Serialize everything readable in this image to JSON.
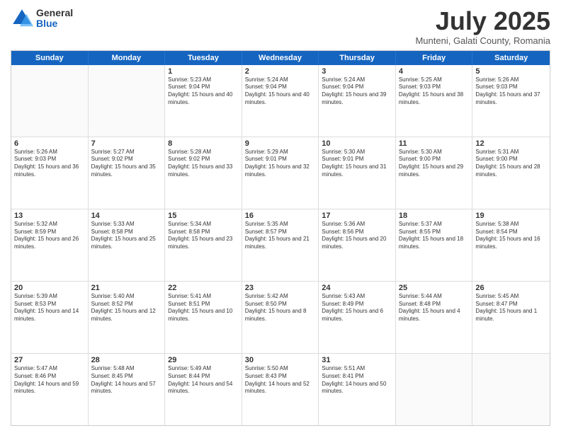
{
  "logo": {
    "general": "General",
    "blue": "Blue"
  },
  "title": "July 2025",
  "location": "Munteni, Galati County, Romania",
  "header_days": [
    "Sunday",
    "Monday",
    "Tuesday",
    "Wednesday",
    "Thursday",
    "Friday",
    "Saturday"
  ],
  "weeks": [
    [
      {
        "day": "",
        "sunrise": "",
        "sunset": "",
        "daylight": ""
      },
      {
        "day": "",
        "sunrise": "",
        "sunset": "",
        "daylight": ""
      },
      {
        "day": "1",
        "sunrise": "Sunrise: 5:23 AM",
        "sunset": "Sunset: 9:04 PM",
        "daylight": "Daylight: 15 hours and 40 minutes."
      },
      {
        "day": "2",
        "sunrise": "Sunrise: 5:24 AM",
        "sunset": "Sunset: 9:04 PM",
        "daylight": "Daylight: 15 hours and 40 minutes."
      },
      {
        "day": "3",
        "sunrise": "Sunrise: 5:24 AM",
        "sunset": "Sunset: 9:04 PM",
        "daylight": "Daylight: 15 hours and 39 minutes."
      },
      {
        "day": "4",
        "sunrise": "Sunrise: 5:25 AM",
        "sunset": "Sunset: 9:03 PM",
        "daylight": "Daylight: 15 hours and 38 minutes."
      },
      {
        "day": "5",
        "sunrise": "Sunrise: 5:26 AM",
        "sunset": "Sunset: 9:03 PM",
        "daylight": "Daylight: 15 hours and 37 minutes."
      }
    ],
    [
      {
        "day": "6",
        "sunrise": "Sunrise: 5:26 AM",
        "sunset": "Sunset: 9:03 PM",
        "daylight": "Daylight: 15 hours and 36 minutes."
      },
      {
        "day": "7",
        "sunrise": "Sunrise: 5:27 AM",
        "sunset": "Sunset: 9:02 PM",
        "daylight": "Daylight: 15 hours and 35 minutes."
      },
      {
        "day": "8",
        "sunrise": "Sunrise: 5:28 AM",
        "sunset": "Sunset: 9:02 PM",
        "daylight": "Daylight: 15 hours and 33 minutes."
      },
      {
        "day": "9",
        "sunrise": "Sunrise: 5:29 AM",
        "sunset": "Sunset: 9:01 PM",
        "daylight": "Daylight: 15 hours and 32 minutes."
      },
      {
        "day": "10",
        "sunrise": "Sunrise: 5:30 AM",
        "sunset": "Sunset: 9:01 PM",
        "daylight": "Daylight: 15 hours and 31 minutes."
      },
      {
        "day": "11",
        "sunrise": "Sunrise: 5:30 AM",
        "sunset": "Sunset: 9:00 PM",
        "daylight": "Daylight: 15 hours and 29 minutes."
      },
      {
        "day": "12",
        "sunrise": "Sunrise: 5:31 AM",
        "sunset": "Sunset: 9:00 PM",
        "daylight": "Daylight: 15 hours and 28 minutes."
      }
    ],
    [
      {
        "day": "13",
        "sunrise": "Sunrise: 5:32 AM",
        "sunset": "Sunset: 8:59 PM",
        "daylight": "Daylight: 15 hours and 26 minutes."
      },
      {
        "day": "14",
        "sunrise": "Sunrise: 5:33 AM",
        "sunset": "Sunset: 8:58 PM",
        "daylight": "Daylight: 15 hours and 25 minutes."
      },
      {
        "day": "15",
        "sunrise": "Sunrise: 5:34 AM",
        "sunset": "Sunset: 8:58 PM",
        "daylight": "Daylight: 15 hours and 23 minutes."
      },
      {
        "day": "16",
        "sunrise": "Sunrise: 5:35 AM",
        "sunset": "Sunset: 8:57 PM",
        "daylight": "Daylight: 15 hours and 21 minutes."
      },
      {
        "day": "17",
        "sunrise": "Sunrise: 5:36 AM",
        "sunset": "Sunset: 8:56 PM",
        "daylight": "Daylight: 15 hours and 20 minutes."
      },
      {
        "day": "18",
        "sunrise": "Sunrise: 5:37 AM",
        "sunset": "Sunset: 8:55 PM",
        "daylight": "Daylight: 15 hours and 18 minutes."
      },
      {
        "day": "19",
        "sunrise": "Sunrise: 5:38 AM",
        "sunset": "Sunset: 8:54 PM",
        "daylight": "Daylight: 15 hours and 16 minutes."
      }
    ],
    [
      {
        "day": "20",
        "sunrise": "Sunrise: 5:39 AM",
        "sunset": "Sunset: 8:53 PM",
        "daylight": "Daylight: 15 hours and 14 minutes."
      },
      {
        "day": "21",
        "sunrise": "Sunrise: 5:40 AM",
        "sunset": "Sunset: 8:52 PM",
        "daylight": "Daylight: 15 hours and 12 minutes."
      },
      {
        "day": "22",
        "sunrise": "Sunrise: 5:41 AM",
        "sunset": "Sunset: 8:51 PM",
        "daylight": "Daylight: 15 hours and 10 minutes."
      },
      {
        "day": "23",
        "sunrise": "Sunrise: 5:42 AM",
        "sunset": "Sunset: 8:50 PM",
        "daylight": "Daylight: 15 hours and 8 minutes."
      },
      {
        "day": "24",
        "sunrise": "Sunrise: 5:43 AM",
        "sunset": "Sunset: 8:49 PM",
        "daylight": "Daylight: 15 hours and 6 minutes."
      },
      {
        "day": "25",
        "sunrise": "Sunrise: 5:44 AM",
        "sunset": "Sunset: 8:48 PM",
        "daylight": "Daylight: 15 hours and 4 minutes."
      },
      {
        "day": "26",
        "sunrise": "Sunrise: 5:45 AM",
        "sunset": "Sunset: 8:47 PM",
        "daylight": "Daylight: 15 hours and 1 minute."
      }
    ],
    [
      {
        "day": "27",
        "sunrise": "Sunrise: 5:47 AM",
        "sunset": "Sunset: 8:46 PM",
        "daylight": "Daylight: 14 hours and 59 minutes."
      },
      {
        "day": "28",
        "sunrise": "Sunrise: 5:48 AM",
        "sunset": "Sunset: 8:45 PM",
        "daylight": "Daylight: 14 hours and 57 minutes."
      },
      {
        "day": "29",
        "sunrise": "Sunrise: 5:49 AM",
        "sunset": "Sunset: 8:44 PM",
        "daylight": "Daylight: 14 hours and 54 minutes."
      },
      {
        "day": "30",
        "sunrise": "Sunrise: 5:50 AM",
        "sunset": "Sunset: 8:43 PM",
        "daylight": "Daylight: 14 hours and 52 minutes."
      },
      {
        "day": "31",
        "sunrise": "Sunrise: 5:51 AM",
        "sunset": "Sunset: 8:41 PM",
        "daylight": "Daylight: 14 hours and 50 minutes."
      },
      {
        "day": "",
        "sunrise": "",
        "sunset": "",
        "daylight": ""
      },
      {
        "day": "",
        "sunrise": "",
        "sunset": "",
        "daylight": ""
      }
    ]
  ]
}
